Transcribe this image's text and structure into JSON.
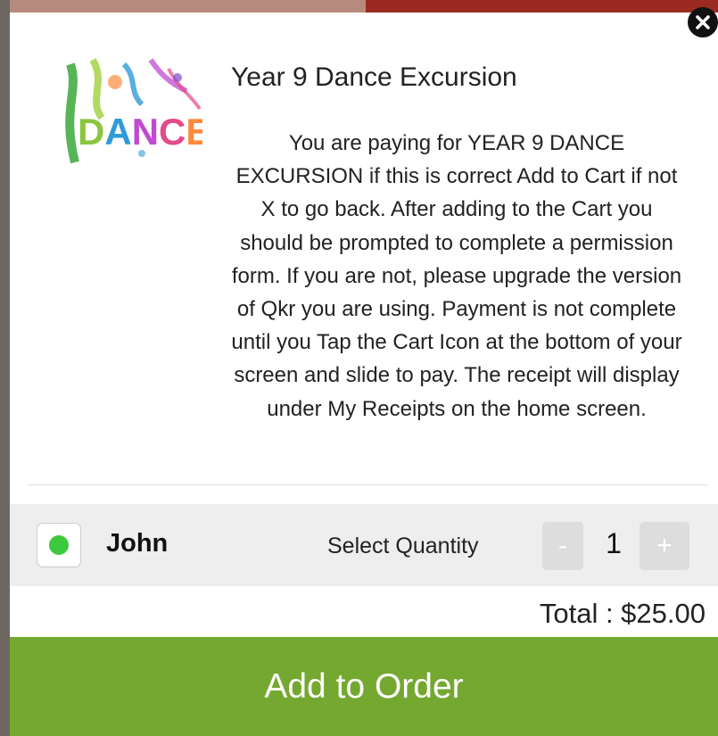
{
  "modal": {
    "title": "Year 9 Dance Excursion",
    "logo_text": "DANCE",
    "description": "You are paying for YEAR 9 DANCE EXCURSION if this is correct Add to Cart if not X to go back. After adding to the Cart you should be prompted to complete a permission form. If you are not, please upgrade the version of Qkr you are using. Payment is not complete until you Tap the Cart Icon at the bottom of your screen and slide to pay. The receipt will display under My Receipts on the home screen.",
    "close_icon": "close-icon"
  },
  "person": {
    "name": "John",
    "status_color": "#3dc93d",
    "select_quantity_label": "Select Quantity",
    "quantity": "1",
    "minus_label": "-",
    "plus_label": "+"
  },
  "total": {
    "label": "Total : $25.00"
  },
  "actions": {
    "add_to_order_label": "Add to Order",
    "accent_color": "#75a830"
  }
}
